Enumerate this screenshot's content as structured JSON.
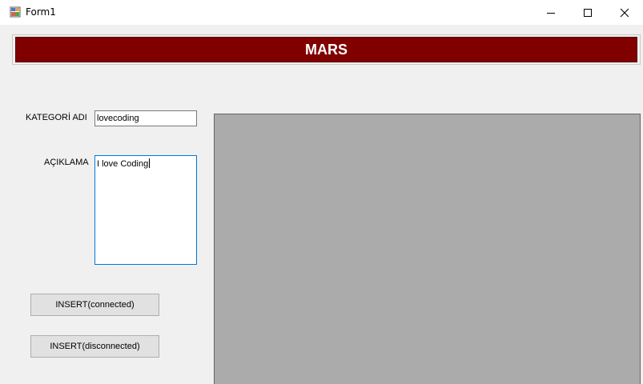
{
  "window": {
    "title": "Form1",
    "icon": "winforms-app-icon"
  },
  "banner": {
    "text": "MARS",
    "color": "#800000"
  },
  "form": {
    "kategori_label": "KATEGORİ ADI",
    "kategori_value": "lovecoding",
    "aciklama_label": "AÇIKLAMA",
    "aciklama_value": "I love Coding"
  },
  "buttons": {
    "insert_connected": "INSERT(connected)",
    "insert_disconnected": "INSERT(disconnected)"
  },
  "grid": {
    "background": "#ababab"
  }
}
